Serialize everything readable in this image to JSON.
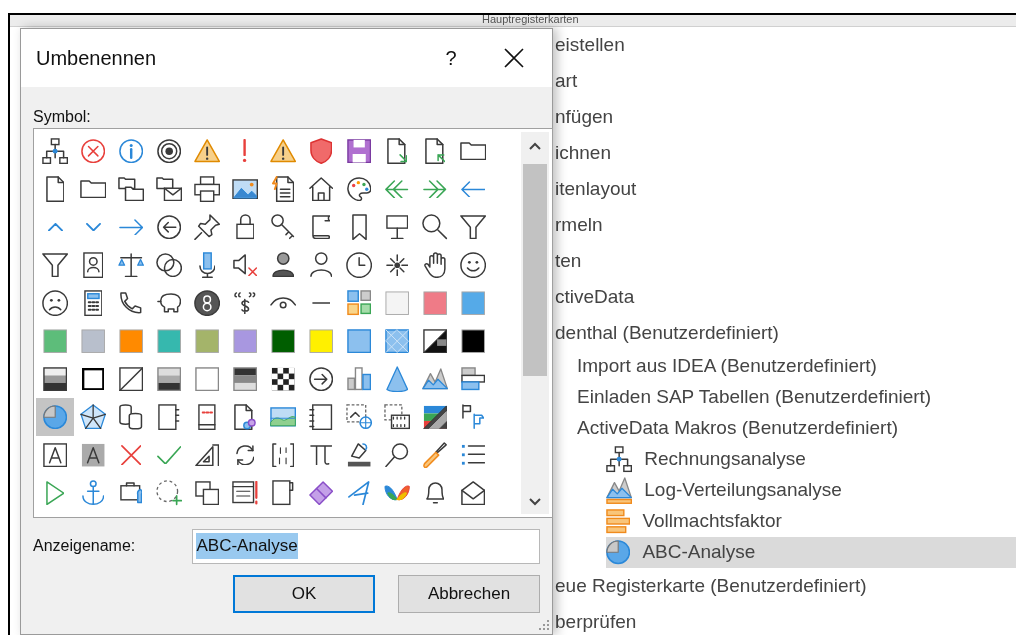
{
  "background": {
    "header": "Hauptregisterkarten",
    "tree": [
      {
        "label": "eistellen",
        "selected": false
      },
      {
        "label": "art",
        "selected": false
      },
      {
        "label": "nfügen",
        "selected": false
      },
      {
        "label": "ichnen",
        "selected": false
      },
      {
        "label": "itenlayout",
        "selected": false
      },
      {
        "label": "rmeln",
        "selected": false
      },
      {
        "label": "ten",
        "selected": false
      },
      {
        "label": "ctiveData",
        "selected": false
      },
      {
        "label": "denthal (Benutzerdefiniert)",
        "selected": false,
        "children": [
          {
            "label": "Import aus IDEA (Benutzerdefiniert)",
            "selected": false
          },
          {
            "label": "Einladen SAP Tabellen (Benutzerdefiniert)",
            "selected": false
          },
          {
            "label": "ActiveData Makros (Benutzerdefiniert)",
            "selected": false,
            "children": [
              {
                "label": "Rechnungsanalyse",
                "selected": false,
                "kind": "hierarchy"
              },
              {
                "label": "Log-Verteilungsanalyse",
                "selected": false,
                "kind": "mountainsbar"
              },
              {
                "label": "Vollmachtsfaktor",
                "selected": false,
                "kind": "orangebars"
              },
              {
                "label": "ABC-Analyse",
                "selected": true,
                "kind": "pie"
              }
            ]
          }
        ]
      },
      {
        "label": "eue Registerkarte (Benutzerdefiniert)",
        "selected": false
      },
      {
        "label": "berprüfen",
        "selected": false
      }
    ]
  },
  "dialog": {
    "title": "Umbenennen",
    "help": "?",
    "symbol_label": "Symbol:",
    "symbols": [
      {
        "kind": "hierarchy",
        "selected": false
      },
      {
        "kind": "error",
        "selected": false
      },
      {
        "kind": "info",
        "selected": false
      },
      {
        "kind": "target",
        "selected": false
      },
      {
        "kind": "warning",
        "selected": false
      },
      {
        "kind": "alert",
        "selected": false
      },
      {
        "kind": "warning",
        "selected": false
      },
      {
        "kind": "shield",
        "selected": false
      },
      {
        "kind": "floppy",
        "selected": false
      },
      {
        "kind": "docout",
        "selected": false
      },
      {
        "kind": "docin",
        "selected": false
      },
      {
        "kind": "folder",
        "selected": false
      },
      {
        "kind": "document",
        "selected": false
      },
      {
        "kind": "folder",
        "selected": false
      },
      {
        "kind": "folders",
        "selected": false
      },
      {
        "kind": "foldermail",
        "selected": false
      },
      {
        "kind": "printer",
        "selected": false
      },
      {
        "kind": "image",
        "selected": false
      },
      {
        "kind": "docflash",
        "selected": false
      },
      {
        "kind": "home",
        "selected": false
      },
      {
        "kind": "palette",
        "selected": false
      },
      {
        "kind": "doubleleft",
        "selected": false
      },
      {
        "kind": "doubleright",
        "selected": false
      },
      {
        "kind": "arrowleft",
        "selected": false
      },
      {
        "kind": "chevronup",
        "selected": false
      },
      {
        "kind": "chevrondown",
        "selected": false
      },
      {
        "kind": "arrowright",
        "selected": false
      },
      {
        "kind": "circleleft",
        "selected": false
      },
      {
        "kind": "pin",
        "selected": false
      },
      {
        "kind": "lock",
        "selected": false
      },
      {
        "kind": "key",
        "selected": false
      },
      {
        "kind": "scroll",
        "selected": false
      },
      {
        "kind": "bookmark",
        "selected": false
      },
      {
        "kind": "easel",
        "selected": false
      },
      {
        "kind": "search",
        "selected": false
      },
      {
        "kind": "filter",
        "selected": false
      },
      {
        "kind": "filter",
        "selected": false
      },
      {
        "kind": "contact",
        "selected": false
      },
      {
        "kind": "scales",
        "selected": false
      },
      {
        "kind": "circles",
        "selected": false
      },
      {
        "kind": "microphone",
        "selected": false
      },
      {
        "kind": "mute",
        "selected": false
      },
      {
        "kind": "personfilled",
        "selected": false
      },
      {
        "kind": "person",
        "selected": false
      },
      {
        "kind": "clock",
        "selected": false
      },
      {
        "kind": "sparkle",
        "selected": false
      },
      {
        "kind": "hand",
        "selected": false
      },
      {
        "kind": "smile",
        "selected": false
      },
      {
        "kind": "frown",
        "selected": false
      },
      {
        "kind": "calculator",
        "selected": false
      },
      {
        "kind": "phone",
        "selected": false
      },
      {
        "kind": "piggy",
        "selected": false
      },
      {
        "kind": "ball",
        "selected": false
      },
      {
        "kind": "quotedollar",
        "selected": false
      },
      {
        "kind": "eye",
        "selected": false
      },
      {
        "kind": "dash",
        "selected": false
      },
      {
        "kind": "tiles",
        "selected": false
      },
      {
        "kind": "swatch",
        "color": "#f4f4f4",
        "selected": false
      },
      {
        "kind": "swatch",
        "color": "#ef7b87",
        "selected": false
      },
      {
        "kind": "swatch",
        "color": "#55aae8",
        "selected": false
      },
      {
        "kind": "swatch",
        "color": "#5dbd7a",
        "selected": false
      },
      {
        "kind": "swatch",
        "color": "#b8bfcc",
        "selected": false
      },
      {
        "kind": "swatch",
        "color": "#ff8a00",
        "selected": false
      },
      {
        "kind": "swatch",
        "color": "#36b8ae",
        "selected": false
      },
      {
        "kind": "swatch",
        "color": "#a4b46a",
        "selected": false
      },
      {
        "kind": "swatch",
        "color": "#a897e0",
        "selected": false
      },
      {
        "kind": "swatch",
        "color": "#005e00",
        "selected": false
      },
      {
        "kind": "swatch",
        "color": "#fff000",
        "selected": false
      },
      {
        "kind": "bluesquare",
        "selected": false
      },
      {
        "kind": "bluepattern",
        "selected": false
      },
      {
        "kind": "bwdiagonal",
        "selected": false
      },
      {
        "kind": "swatch",
        "color": "#000000",
        "selected": false
      },
      {
        "kind": "gradientdark",
        "selected": false
      },
      {
        "kind": "blackframe",
        "selected": false
      },
      {
        "kind": "diagonal",
        "selected": false
      },
      {
        "kind": "gradientgray",
        "selected": false
      },
      {
        "kind": "blank",
        "selected": false
      },
      {
        "kind": "gradientlight",
        "selected": false
      },
      {
        "kind": "checker",
        "selected": false
      },
      {
        "kind": "circleright",
        "selected": false
      },
      {
        "kind": "barchart",
        "selected": false
      },
      {
        "kind": "cone",
        "selected": false
      },
      {
        "kind": "mountains",
        "selected": false
      },
      {
        "kind": "stackedbars",
        "selected": false
      },
      {
        "kind": "pie",
        "selected": true
      },
      {
        "kind": "radar",
        "selected": false
      },
      {
        "kind": "cylinders",
        "selected": false
      },
      {
        "kind": "notebook",
        "selected": false
      },
      {
        "kind": "bookdots",
        "selected": false
      },
      {
        "kind": "docshapes",
        "selected": false
      },
      {
        "kind": "landscape",
        "selected": false
      },
      {
        "kind": "binder",
        "selected": false
      },
      {
        "kind": "imageglobe",
        "selected": false
      },
      {
        "kind": "imagefilm",
        "selected": false
      },
      {
        "kind": "colordiagonal",
        "selected": false
      },
      {
        "kind": "flags",
        "selected": false
      },
      {
        "kind": "letterbox",
        "selected": false
      },
      {
        "kind": "lettergray",
        "selected": false
      },
      {
        "kind": "cross",
        "selected": false
      },
      {
        "kind": "check",
        "selected": false
      },
      {
        "kind": "ruler",
        "selected": false
      },
      {
        "kind": "refresh",
        "selected": false
      },
      {
        "kind": "binary",
        "selected": false
      },
      {
        "kind": "pi",
        "selected": false
      },
      {
        "kind": "bucket",
        "selected": false
      },
      {
        "kind": "magnifier",
        "selected": false
      },
      {
        "kind": "brush",
        "selected": false
      },
      {
        "kind": "list",
        "selected": false
      },
      {
        "kind": "play",
        "selected": false
      },
      {
        "kind": "anchor",
        "selected": false
      },
      {
        "kind": "toolcase",
        "selected": false
      },
      {
        "kind": "dashedcircle",
        "selected": false
      },
      {
        "kind": "copy",
        "selected": false
      },
      {
        "kind": "tablealert",
        "selected": false
      },
      {
        "kind": "notepad",
        "selected": false
      },
      {
        "kind": "eraser",
        "selected": false
      },
      {
        "kind": "cursor",
        "selected": false
      },
      {
        "kind": "butterfly",
        "selected": false
      },
      {
        "kind": "bell",
        "selected": false
      },
      {
        "kind": "envelope",
        "selected": false
      }
    ],
    "name_label": "Anzeigename:",
    "name_field": {
      "value": "ABC-Analyse",
      "value_selected": true
    },
    "buttons": [
      {
        "label": "OK",
        "default": true
      },
      {
        "label": "Abbrechen",
        "default": false
      }
    ]
  }
}
